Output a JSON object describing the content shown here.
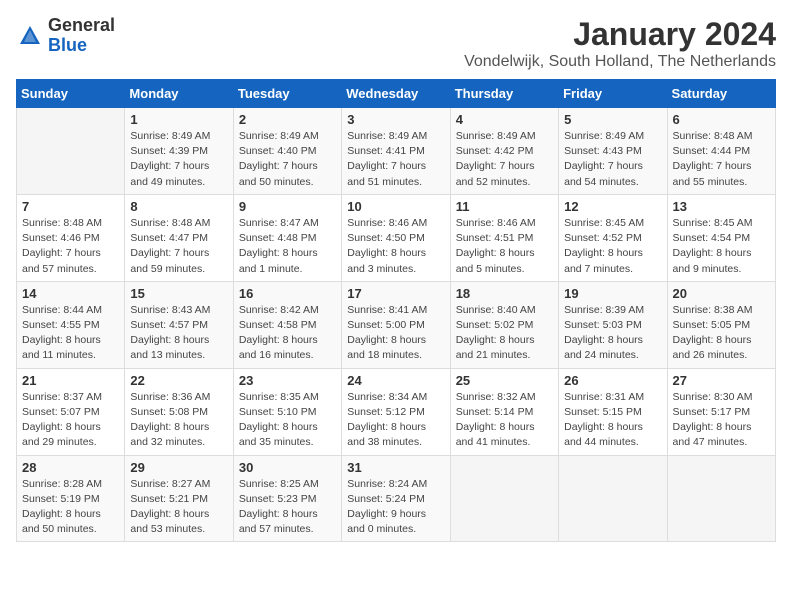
{
  "logo": {
    "general": "General",
    "blue": "Blue"
  },
  "title": "January 2024",
  "location": "Vondelwijk, South Holland, The Netherlands",
  "days_of_week": [
    "Sunday",
    "Monday",
    "Tuesday",
    "Wednesday",
    "Thursday",
    "Friday",
    "Saturday"
  ],
  "weeks": [
    [
      {
        "day": "",
        "info": ""
      },
      {
        "day": "1",
        "info": "Sunrise: 8:49 AM\nSunset: 4:39 PM\nDaylight: 7 hours\nand 49 minutes."
      },
      {
        "day": "2",
        "info": "Sunrise: 8:49 AM\nSunset: 4:40 PM\nDaylight: 7 hours\nand 50 minutes."
      },
      {
        "day": "3",
        "info": "Sunrise: 8:49 AM\nSunset: 4:41 PM\nDaylight: 7 hours\nand 51 minutes."
      },
      {
        "day": "4",
        "info": "Sunrise: 8:49 AM\nSunset: 4:42 PM\nDaylight: 7 hours\nand 52 minutes."
      },
      {
        "day": "5",
        "info": "Sunrise: 8:49 AM\nSunset: 4:43 PM\nDaylight: 7 hours\nand 54 minutes."
      },
      {
        "day": "6",
        "info": "Sunrise: 8:48 AM\nSunset: 4:44 PM\nDaylight: 7 hours\nand 55 minutes."
      }
    ],
    [
      {
        "day": "7",
        "info": "Sunrise: 8:48 AM\nSunset: 4:46 PM\nDaylight: 7 hours\nand 57 minutes."
      },
      {
        "day": "8",
        "info": "Sunrise: 8:48 AM\nSunset: 4:47 PM\nDaylight: 7 hours\nand 59 minutes."
      },
      {
        "day": "9",
        "info": "Sunrise: 8:47 AM\nSunset: 4:48 PM\nDaylight: 8 hours\nand 1 minute."
      },
      {
        "day": "10",
        "info": "Sunrise: 8:46 AM\nSunset: 4:50 PM\nDaylight: 8 hours\nand 3 minutes."
      },
      {
        "day": "11",
        "info": "Sunrise: 8:46 AM\nSunset: 4:51 PM\nDaylight: 8 hours\nand 5 minutes."
      },
      {
        "day": "12",
        "info": "Sunrise: 8:45 AM\nSunset: 4:52 PM\nDaylight: 8 hours\nand 7 minutes."
      },
      {
        "day": "13",
        "info": "Sunrise: 8:45 AM\nSunset: 4:54 PM\nDaylight: 8 hours\nand 9 minutes."
      }
    ],
    [
      {
        "day": "14",
        "info": "Sunrise: 8:44 AM\nSunset: 4:55 PM\nDaylight: 8 hours\nand 11 minutes."
      },
      {
        "day": "15",
        "info": "Sunrise: 8:43 AM\nSunset: 4:57 PM\nDaylight: 8 hours\nand 13 minutes."
      },
      {
        "day": "16",
        "info": "Sunrise: 8:42 AM\nSunset: 4:58 PM\nDaylight: 8 hours\nand 16 minutes."
      },
      {
        "day": "17",
        "info": "Sunrise: 8:41 AM\nSunset: 5:00 PM\nDaylight: 8 hours\nand 18 minutes."
      },
      {
        "day": "18",
        "info": "Sunrise: 8:40 AM\nSunset: 5:02 PM\nDaylight: 8 hours\nand 21 minutes."
      },
      {
        "day": "19",
        "info": "Sunrise: 8:39 AM\nSunset: 5:03 PM\nDaylight: 8 hours\nand 24 minutes."
      },
      {
        "day": "20",
        "info": "Sunrise: 8:38 AM\nSunset: 5:05 PM\nDaylight: 8 hours\nand 26 minutes."
      }
    ],
    [
      {
        "day": "21",
        "info": "Sunrise: 8:37 AM\nSunset: 5:07 PM\nDaylight: 8 hours\nand 29 minutes."
      },
      {
        "day": "22",
        "info": "Sunrise: 8:36 AM\nSunset: 5:08 PM\nDaylight: 8 hours\nand 32 minutes."
      },
      {
        "day": "23",
        "info": "Sunrise: 8:35 AM\nSunset: 5:10 PM\nDaylight: 8 hours\nand 35 minutes."
      },
      {
        "day": "24",
        "info": "Sunrise: 8:34 AM\nSunset: 5:12 PM\nDaylight: 8 hours\nand 38 minutes."
      },
      {
        "day": "25",
        "info": "Sunrise: 8:32 AM\nSunset: 5:14 PM\nDaylight: 8 hours\nand 41 minutes."
      },
      {
        "day": "26",
        "info": "Sunrise: 8:31 AM\nSunset: 5:15 PM\nDaylight: 8 hours\nand 44 minutes."
      },
      {
        "day": "27",
        "info": "Sunrise: 8:30 AM\nSunset: 5:17 PM\nDaylight: 8 hours\nand 47 minutes."
      }
    ],
    [
      {
        "day": "28",
        "info": "Sunrise: 8:28 AM\nSunset: 5:19 PM\nDaylight: 8 hours\nand 50 minutes."
      },
      {
        "day": "29",
        "info": "Sunrise: 8:27 AM\nSunset: 5:21 PM\nDaylight: 8 hours\nand 53 minutes."
      },
      {
        "day": "30",
        "info": "Sunrise: 8:25 AM\nSunset: 5:23 PM\nDaylight: 8 hours\nand 57 minutes."
      },
      {
        "day": "31",
        "info": "Sunrise: 8:24 AM\nSunset: 5:24 PM\nDaylight: 9 hours\nand 0 minutes."
      },
      {
        "day": "",
        "info": ""
      },
      {
        "day": "",
        "info": ""
      },
      {
        "day": "",
        "info": ""
      }
    ]
  ]
}
